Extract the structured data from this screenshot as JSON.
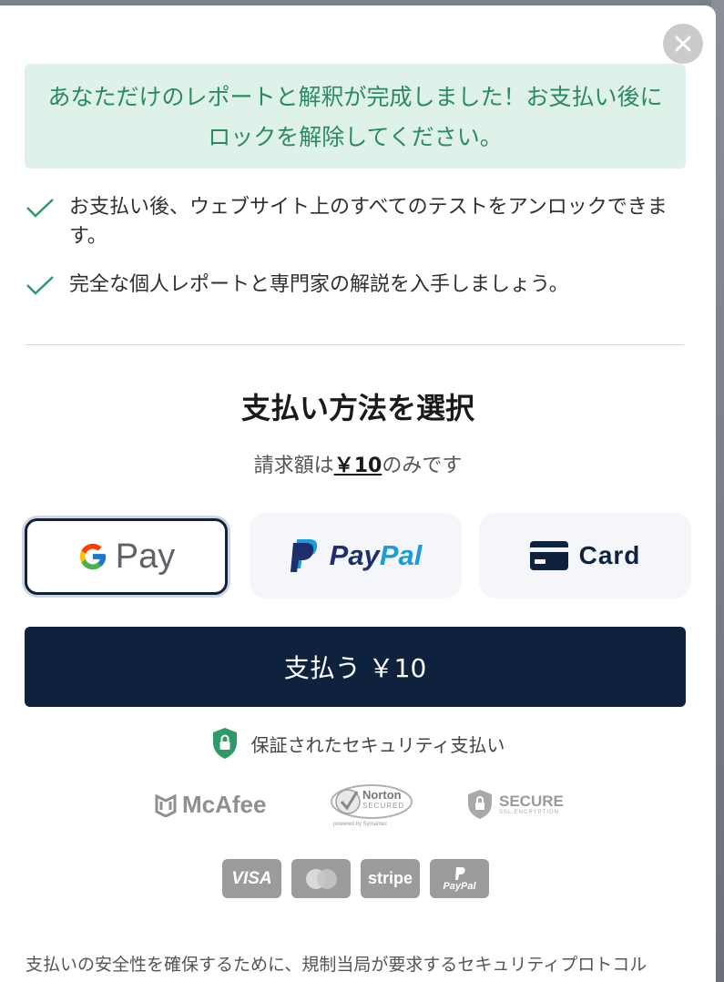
{
  "close": {
    "icon": "close-icon"
  },
  "banner": {
    "text": "あなただけのレポートと解釈が完成しました！お支払い後にロックを解除してください。"
  },
  "benefits": [
    {
      "icon": "check-icon",
      "text": "お支払い後、ウェブサイト上のすべてのテストをアンロックできます。"
    },
    {
      "icon": "check-icon",
      "text": "完全な個人レポートと専門家の解説を入手しましょう。"
    }
  ],
  "payment": {
    "title": "支払い方法を選択",
    "subtitle_prefix": "請求額は",
    "amount": "￥10",
    "subtitle_suffix": "のみです",
    "methods": [
      {
        "label": "Pay",
        "icon": "google-g-icon",
        "selected": true
      },
      {
        "label_a": "Pay",
        "label_b": "Pal",
        "icon": "paypal-p-icon",
        "selected": false
      },
      {
        "label": "Card",
        "icon": "credit-card-icon",
        "selected": false
      }
    ],
    "pay_button": "支払う ￥10"
  },
  "security": {
    "text": "保証されたセキュリティ支払い",
    "icon": "lock-shield-icon",
    "badges": {
      "mcafee": "McAfee",
      "norton_name": "Norton",
      "norton_sub": "SECURED",
      "norton_powered": "powered by Symantec",
      "secure_main": "SECURE",
      "secure_sub": "SSL ENCRYPTION"
    },
    "card_brands": {
      "visa": "VISA",
      "stripe": "stripe",
      "paypal": "PayPal"
    }
  },
  "footer": "支払いの安全性を確保するために、規制当局が要求するセキュリティプロトコル",
  "colors": {
    "accent": "#0f223d",
    "banner_bg": "#dff2ea",
    "banner_text": "#2b8a63",
    "check": "#2e9a6a"
  }
}
